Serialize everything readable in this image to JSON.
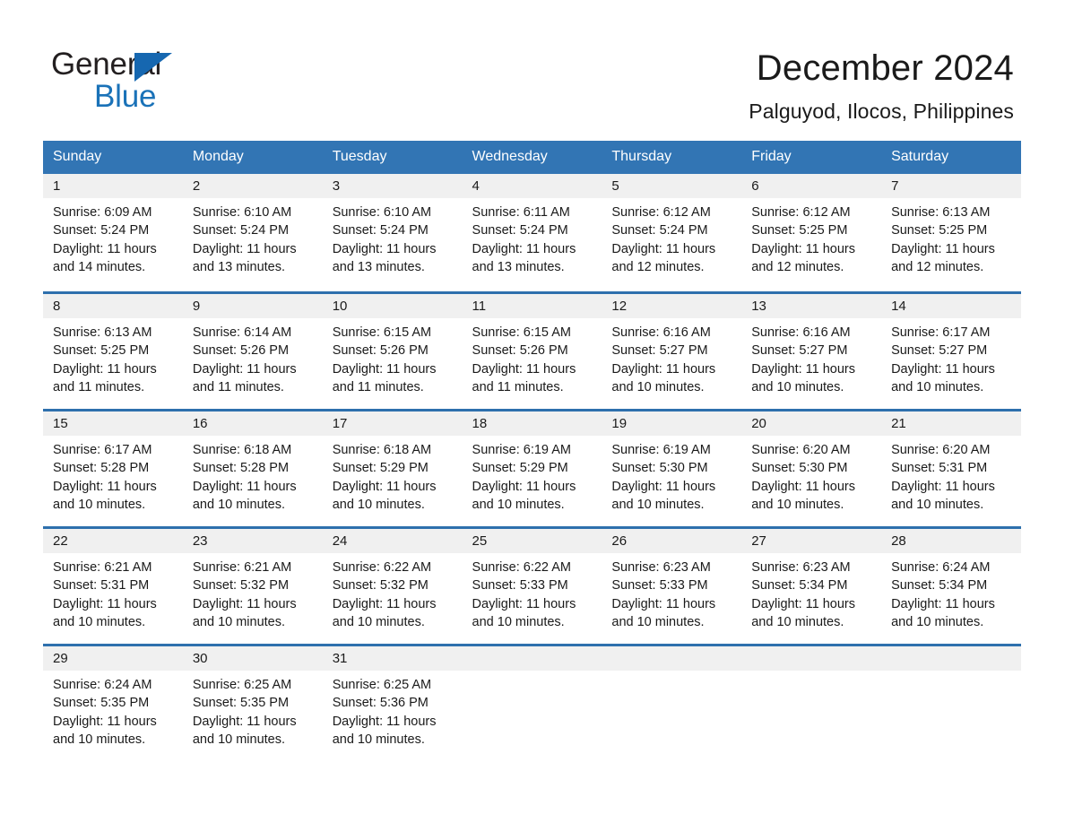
{
  "brand": {
    "name_part1": "General",
    "name_part2": "Blue",
    "triangle_color": "#1667b0",
    "accent_color": "#3275b4"
  },
  "header": {
    "title": "December 2024",
    "subtitle": "Palguyod, Ilocos, Philippines"
  },
  "calendar": {
    "weekday_headers": [
      "Sunday",
      "Monday",
      "Tuesday",
      "Wednesday",
      "Thursday",
      "Friday",
      "Saturday"
    ],
    "header_bg": "#3275b4",
    "row_border_color": "#2e70ad",
    "daynum_bg": "#f0f0f0",
    "weeks": [
      [
        {
          "day": "1",
          "sunrise": "Sunrise: 6:09 AM",
          "sunset": "Sunset: 5:24 PM",
          "daylight_line1": "Daylight: 11 hours",
          "daylight_line2": "and 14 minutes."
        },
        {
          "day": "2",
          "sunrise": "Sunrise: 6:10 AM",
          "sunset": "Sunset: 5:24 PM",
          "daylight_line1": "Daylight: 11 hours",
          "daylight_line2": "and 13 minutes."
        },
        {
          "day": "3",
          "sunrise": "Sunrise: 6:10 AM",
          "sunset": "Sunset: 5:24 PM",
          "daylight_line1": "Daylight: 11 hours",
          "daylight_line2": "and 13 minutes."
        },
        {
          "day": "4",
          "sunrise": "Sunrise: 6:11 AM",
          "sunset": "Sunset: 5:24 PM",
          "daylight_line1": "Daylight: 11 hours",
          "daylight_line2": "and 13 minutes."
        },
        {
          "day": "5",
          "sunrise": "Sunrise: 6:12 AM",
          "sunset": "Sunset: 5:24 PM",
          "daylight_line1": "Daylight: 11 hours",
          "daylight_line2": "and 12 minutes."
        },
        {
          "day": "6",
          "sunrise": "Sunrise: 6:12 AM",
          "sunset": "Sunset: 5:25 PM",
          "daylight_line1": "Daylight: 11 hours",
          "daylight_line2": "and 12 minutes."
        },
        {
          "day": "7",
          "sunrise": "Sunrise: 6:13 AM",
          "sunset": "Sunset: 5:25 PM",
          "daylight_line1": "Daylight: 11 hours",
          "daylight_line2": "and 12 minutes."
        }
      ],
      [
        {
          "day": "8",
          "sunrise": "Sunrise: 6:13 AM",
          "sunset": "Sunset: 5:25 PM",
          "daylight_line1": "Daylight: 11 hours",
          "daylight_line2": "and 11 minutes."
        },
        {
          "day": "9",
          "sunrise": "Sunrise: 6:14 AM",
          "sunset": "Sunset: 5:26 PM",
          "daylight_line1": "Daylight: 11 hours",
          "daylight_line2": "and 11 minutes."
        },
        {
          "day": "10",
          "sunrise": "Sunrise: 6:15 AM",
          "sunset": "Sunset: 5:26 PM",
          "daylight_line1": "Daylight: 11 hours",
          "daylight_line2": "and 11 minutes."
        },
        {
          "day": "11",
          "sunrise": "Sunrise: 6:15 AM",
          "sunset": "Sunset: 5:26 PM",
          "daylight_line1": "Daylight: 11 hours",
          "daylight_line2": "and 11 minutes."
        },
        {
          "day": "12",
          "sunrise": "Sunrise: 6:16 AM",
          "sunset": "Sunset: 5:27 PM",
          "daylight_line1": "Daylight: 11 hours",
          "daylight_line2": "and 10 minutes."
        },
        {
          "day": "13",
          "sunrise": "Sunrise: 6:16 AM",
          "sunset": "Sunset: 5:27 PM",
          "daylight_line1": "Daylight: 11 hours",
          "daylight_line2": "and 10 minutes."
        },
        {
          "day": "14",
          "sunrise": "Sunrise: 6:17 AM",
          "sunset": "Sunset: 5:27 PM",
          "daylight_line1": "Daylight: 11 hours",
          "daylight_line2": "and 10 minutes."
        }
      ],
      [
        {
          "day": "15",
          "sunrise": "Sunrise: 6:17 AM",
          "sunset": "Sunset: 5:28 PM",
          "daylight_line1": "Daylight: 11 hours",
          "daylight_line2": "and 10 minutes."
        },
        {
          "day": "16",
          "sunrise": "Sunrise: 6:18 AM",
          "sunset": "Sunset: 5:28 PM",
          "daylight_line1": "Daylight: 11 hours",
          "daylight_line2": "and 10 minutes."
        },
        {
          "day": "17",
          "sunrise": "Sunrise: 6:18 AM",
          "sunset": "Sunset: 5:29 PM",
          "daylight_line1": "Daylight: 11 hours",
          "daylight_line2": "and 10 minutes."
        },
        {
          "day": "18",
          "sunrise": "Sunrise: 6:19 AM",
          "sunset": "Sunset: 5:29 PM",
          "daylight_line1": "Daylight: 11 hours",
          "daylight_line2": "and 10 minutes."
        },
        {
          "day": "19",
          "sunrise": "Sunrise: 6:19 AM",
          "sunset": "Sunset: 5:30 PM",
          "daylight_line1": "Daylight: 11 hours",
          "daylight_line2": "and 10 minutes."
        },
        {
          "day": "20",
          "sunrise": "Sunrise: 6:20 AM",
          "sunset": "Sunset: 5:30 PM",
          "daylight_line1": "Daylight: 11 hours",
          "daylight_line2": "and 10 minutes."
        },
        {
          "day": "21",
          "sunrise": "Sunrise: 6:20 AM",
          "sunset": "Sunset: 5:31 PM",
          "daylight_line1": "Daylight: 11 hours",
          "daylight_line2": "and 10 minutes."
        }
      ],
      [
        {
          "day": "22",
          "sunrise": "Sunrise: 6:21 AM",
          "sunset": "Sunset: 5:31 PM",
          "daylight_line1": "Daylight: 11 hours",
          "daylight_line2": "and 10 minutes."
        },
        {
          "day": "23",
          "sunrise": "Sunrise: 6:21 AM",
          "sunset": "Sunset: 5:32 PM",
          "daylight_line1": "Daylight: 11 hours",
          "daylight_line2": "and 10 minutes."
        },
        {
          "day": "24",
          "sunrise": "Sunrise: 6:22 AM",
          "sunset": "Sunset: 5:32 PM",
          "daylight_line1": "Daylight: 11 hours",
          "daylight_line2": "and 10 minutes."
        },
        {
          "day": "25",
          "sunrise": "Sunrise: 6:22 AM",
          "sunset": "Sunset: 5:33 PM",
          "daylight_line1": "Daylight: 11 hours",
          "daylight_line2": "and 10 minutes."
        },
        {
          "day": "26",
          "sunrise": "Sunrise: 6:23 AM",
          "sunset": "Sunset: 5:33 PM",
          "daylight_line1": "Daylight: 11 hours",
          "daylight_line2": "and 10 minutes."
        },
        {
          "day": "27",
          "sunrise": "Sunrise: 6:23 AM",
          "sunset": "Sunset: 5:34 PM",
          "daylight_line1": "Daylight: 11 hours",
          "daylight_line2": "and 10 minutes."
        },
        {
          "day": "28",
          "sunrise": "Sunrise: 6:24 AM",
          "sunset": "Sunset: 5:34 PM",
          "daylight_line1": "Daylight: 11 hours",
          "daylight_line2": "and 10 minutes."
        }
      ],
      [
        {
          "day": "29",
          "sunrise": "Sunrise: 6:24 AM",
          "sunset": "Sunset: 5:35 PM",
          "daylight_line1": "Daylight: 11 hours",
          "daylight_line2": "and 10 minutes."
        },
        {
          "day": "30",
          "sunrise": "Sunrise: 6:25 AM",
          "sunset": "Sunset: 5:35 PM",
          "daylight_line1": "Daylight: 11 hours",
          "daylight_line2": "and 10 minutes."
        },
        {
          "day": "31",
          "sunrise": "Sunrise: 6:25 AM",
          "sunset": "Sunset: 5:36 PM",
          "daylight_line1": "Daylight: 11 hours",
          "daylight_line2": "and 10 minutes."
        },
        {
          "day": "",
          "sunrise": "",
          "sunset": "",
          "daylight_line1": "",
          "daylight_line2": ""
        },
        {
          "day": "",
          "sunrise": "",
          "sunset": "",
          "daylight_line1": "",
          "daylight_line2": ""
        },
        {
          "day": "",
          "sunrise": "",
          "sunset": "",
          "daylight_line1": "",
          "daylight_line2": ""
        },
        {
          "day": "",
          "sunrise": "",
          "sunset": "",
          "daylight_line1": "",
          "daylight_line2": ""
        }
      ]
    ]
  }
}
